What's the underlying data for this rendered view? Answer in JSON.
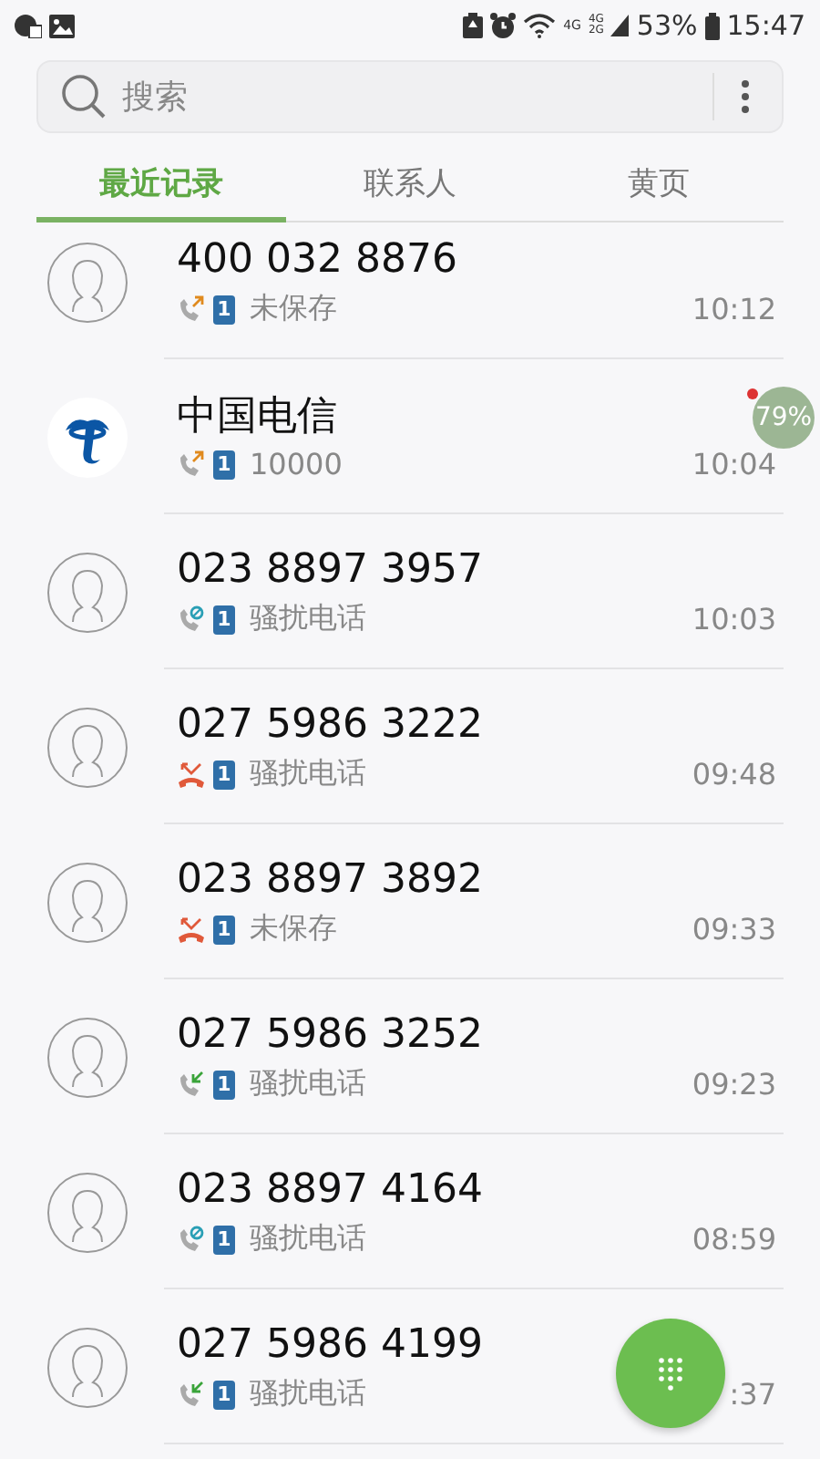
{
  "status_bar": {
    "network_labels": [
      "4G",
      "4G",
      "2G"
    ],
    "battery": "53%",
    "time": "15:47"
  },
  "search": {
    "placeholder": "搜索"
  },
  "tabs": [
    {
      "label": "最近记录",
      "selected": true
    },
    {
      "label": "联系人",
      "selected": false
    },
    {
      "label": "黄页",
      "selected": false
    }
  ],
  "calls": [
    {
      "number": "400 032 8876",
      "avatar": {
        "kind": "person"
      },
      "call_icon": {
        "kind": "outgoing"
      },
      "sim": "1",
      "label": "未保存",
      "time": "10:12"
    },
    {
      "number": "中国电信",
      "avatar": {
        "kind": "logo"
      },
      "call_icon": {
        "kind": "outgoing"
      },
      "sim": "1",
      "label": "10000",
      "time": "10:04"
    },
    {
      "number": "023 8897 3957",
      "avatar": {
        "kind": "person"
      },
      "call_icon": {
        "kind": "blocked"
      },
      "sim": "1",
      "label": "骚扰电话",
      "time": "10:03"
    },
    {
      "number": "027 5986 3222",
      "avatar": {
        "kind": "person"
      },
      "call_icon": {
        "kind": "rejected"
      },
      "sim": "1",
      "label": "骚扰电话",
      "time": "09:48"
    },
    {
      "number": "023 8897 3892",
      "avatar": {
        "kind": "person"
      },
      "call_icon": {
        "kind": "rejected"
      },
      "sim": "1",
      "label": "未保存",
      "time": "09:33"
    },
    {
      "number": "027 5986 3252",
      "avatar": {
        "kind": "person"
      },
      "call_icon": {
        "kind": "incoming"
      },
      "sim": "1",
      "label": "骚扰电话",
      "time": "09:23"
    },
    {
      "number": "023 8897 4164",
      "avatar": {
        "kind": "person"
      },
      "call_icon": {
        "kind": "blocked"
      },
      "sim": "1",
      "label": "骚扰电话",
      "time": "08:59"
    },
    {
      "number": "027 5986 4199",
      "avatar": {
        "kind": "person"
      },
      "call_icon": {
        "kind": "incoming"
      },
      "sim": "1",
      "label": "骚扰电话",
      "time": ":37"
    }
  ],
  "floating_widget": {
    "text": "79%"
  }
}
